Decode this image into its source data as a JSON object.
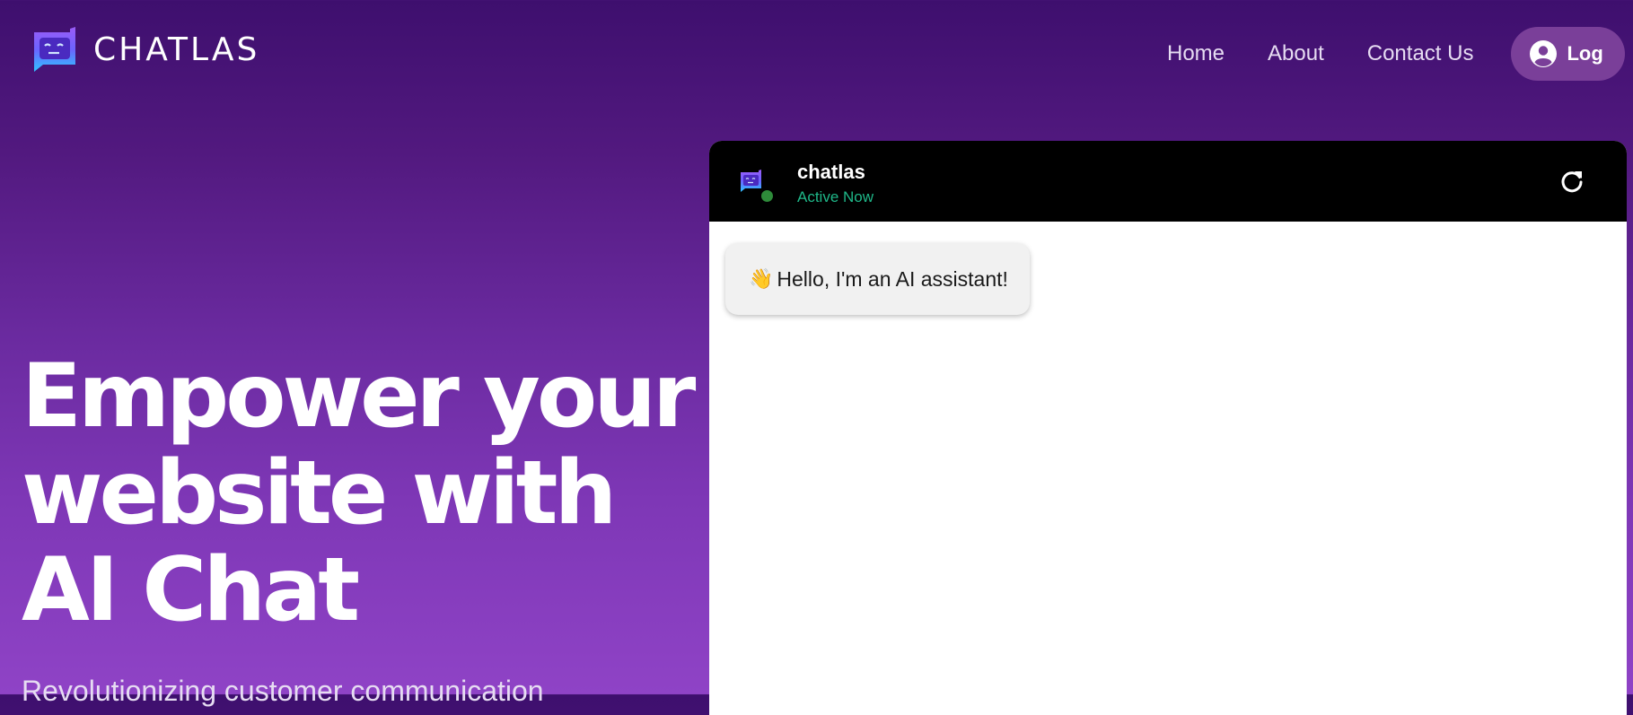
{
  "brand": {
    "name": "CHATLAS",
    "logo_icon": "chatlas-logo-icon"
  },
  "nav": {
    "links": [
      {
        "label": "Home"
      },
      {
        "label": "About"
      },
      {
        "label": "Contact Us"
      }
    ],
    "login": {
      "label": "Log",
      "icon": "user-circle-icon"
    }
  },
  "hero": {
    "title_lines": [
      "Empower your",
      "website with",
      "AI Chat"
    ],
    "subtitle": "Revolutionizing customer communication"
  },
  "chat": {
    "name": "chatlas",
    "status": "Active Now",
    "refresh_icon": "refresh-icon",
    "messages": [
      {
        "emoji": "👋",
        "text": "Hello, I'm an AI assistant!"
      }
    ]
  },
  "colors": {
    "gradient_top": "#3e0f6e",
    "gradient_bottom": "#8f43c6",
    "login_bg": "#7a3f99",
    "chat_header_bg": "#000000",
    "status_green": "#1fb889",
    "online_dot": "#2e8b3a",
    "bubble_bg": "#f1f1f1"
  }
}
